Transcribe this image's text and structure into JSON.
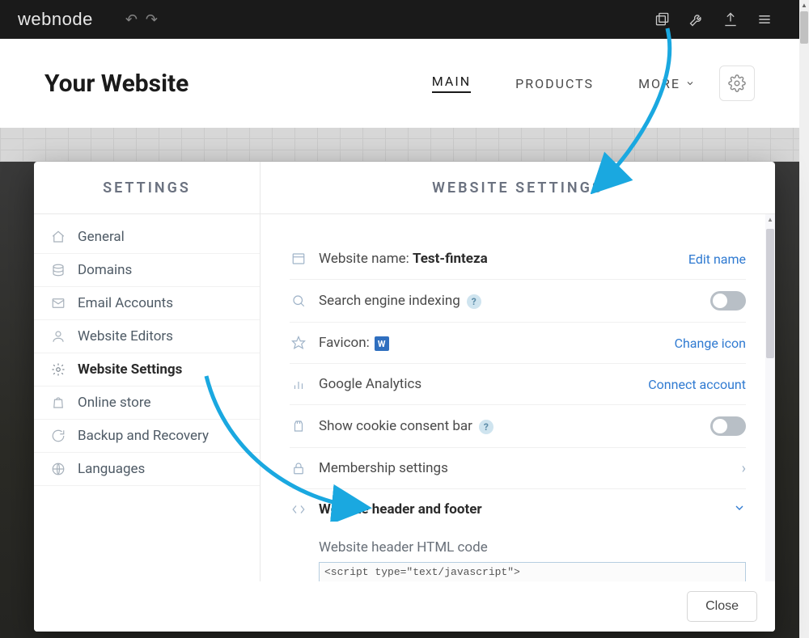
{
  "appbar": {
    "logo": "webnode"
  },
  "site": {
    "title": "Your Website",
    "nav_main": "MAIN",
    "nav_products": "PRODUCTS",
    "nav_more": "MORE"
  },
  "modal": {
    "sidebar_title": "SETTINGS",
    "panel_title": "WEBSITE SETTINGS",
    "sidebar": {
      "items": [
        {
          "label": "General"
        },
        {
          "label": "Domains"
        },
        {
          "label": "Email Accounts"
        },
        {
          "label": "Website Editors"
        },
        {
          "label": "Website Settings"
        },
        {
          "label": "Online store"
        },
        {
          "label": "Backup and Recovery"
        },
        {
          "label": "Languages"
        }
      ]
    },
    "content": {
      "website_name_label": "Website name:",
      "website_name_value": "Test-finteza",
      "edit_name": "Edit name",
      "search_indexing": "Search engine indexing",
      "favicon_label": "Favicon:",
      "favicon_mark": "W",
      "change_icon": "Change icon",
      "google_analytics": "Google Analytics",
      "connect_account": "Connect account",
      "cookie_bar": "Show cookie consent bar",
      "membership": "Membership settings",
      "header_footer": "Website header and footer",
      "header_code_label": "Website header HTML code",
      "header_code": "<script type=\"text/javascript\">\n  (function(a,e,f,g,b,c,d){a[b]||\n(a.FintezaCoreObject=b,a[b]=a[b]||function()"
    },
    "close": "Close"
  }
}
